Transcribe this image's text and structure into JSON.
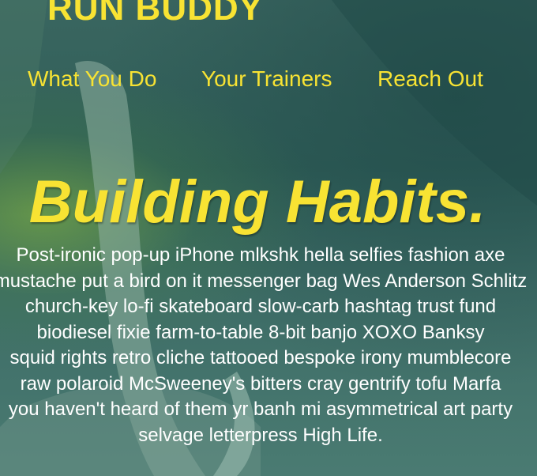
{
  "header": {
    "brand": "RUN BUDDY",
    "nav": [
      "What You Do",
      "Your Trainers",
      "Reach Out"
    ]
  },
  "hero": {
    "headline": "Building Habits.",
    "body_lines": [
      "Post-ironic pop-up iPhone mlkshk hella selfies fashion axe",
      "mustache put a bird on it messenger bag Wes Anderson Schlitz",
      "church-key lo-fi skateboard slow-carb hashtag trust fund",
      "biodiesel fixie farm-to-table 8-bit banjo XOXO Banksy",
      "squid rights retro cliche tattooed bespoke irony mumblecore",
      "raw polaroid McSweeney's bitters cray gentrify tofu Marfa",
      "you haven't heard of them yr banh mi asymmetrical art party",
      "selvage letterpress High Life."
    ]
  },
  "colors": {
    "accent": "#f8e333",
    "body_text": "#ffffff",
    "overlay": "#2f5a55"
  }
}
